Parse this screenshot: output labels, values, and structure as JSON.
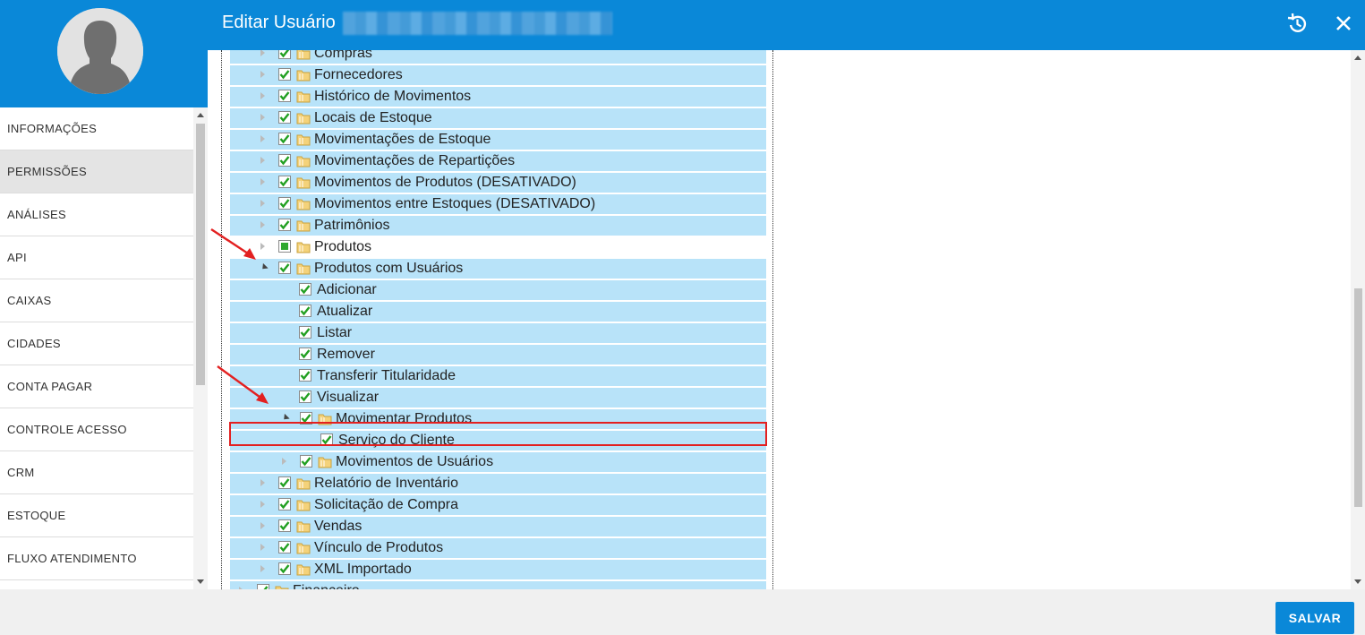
{
  "header": {
    "title": "Editar Usuário",
    "history_icon": "history-icon",
    "close_icon": "close-icon",
    "accent": "#0a88d8"
  },
  "sidebar": {
    "items": [
      {
        "label": "INFORMAÇÕES",
        "active": false
      },
      {
        "label": "PERMISSÕES",
        "active": true
      },
      {
        "label": "ANÁLISES",
        "active": false
      },
      {
        "label": "API",
        "active": false
      },
      {
        "label": "CAIXAS",
        "active": false
      },
      {
        "label": "CIDADES",
        "active": false
      },
      {
        "label": "CONTA PAGAR",
        "active": false
      },
      {
        "label": "CONTROLE ACESSO",
        "active": false
      },
      {
        "label": "CRM",
        "active": false
      },
      {
        "label": "ESTOQUE",
        "active": false
      },
      {
        "label": "FLUXO ATENDIMENTO",
        "active": false
      }
    ]
  },
  "tree": {
    "rows": [
      {
        "label": "Compras",
        "level": 2,
        "folder": true,
        "expander": "closed",
        "check": "full"
      },
      {
        "label": "Fornecedores",
        "level": 2,
        "folder": true,
        "expander": "closed",
        "check": "full"
      },
      {
        "label": "Histórico de Movimentos",
        "level": 2,
        "folder": true,
        "expander": "closed",
        "check": "full"
      },
      {
        "label": "Locais de Estoque",
        "level": 2,
        "folder": true,
        "expander": "closed",
        "check": "full"
      },
      {
        "label": "Movimentações de Estoque",
        "level": 2,
        "folder": true,
        "expander": "closed",
        "check": "full"
      },
      {
        "label": "Movimentações de Repartições",
        "level": 2,
        "folder": true,
        "expander": "closed",
        "check": "full"
      },
      {
        "label": "Movimentos de Produtos (DESATIVADO)",
        "level": 2,
        "folder": true,
        "expander": "closed",
        "check": "full"
      },
      {
        "label": "Movimentos entre Estoques (DESATIVADO)",
        "level": 2,
        "folder": true,
        "expander": "closed",
        "check": "full"
      },
      {
        "label": "Patrimônios",
        "level": 2,
        "folder": true,
        "expander": "closed",
        "check": "full"
      },
      {
        "label": "Produtos",
        "level": 2,
        "folder": true,
        "expander": "closed",
        "check": "partial",
        "plain": true
      },
      {
        "label": "Produtos com Usuários",
        "level": 2,
        "folder": true,
        "expander": "open",
        "check": "full"
      },
      {
        "label": "Adicionar",
        "level": 3,
        "folder": false,
        "expander": "none",
        "check": "full"
      },
      {
        "label": "Atualizar",
        "level": 3,
        "folder": false,
        "expander": "none",
        "check": "full"
      },
      {
        "label": "Listar",
        "level": 3,
        "folder": false,
        "expander": "none",
        "check": "full"
      },
      {
        "label": "Remover",
        "level": 3,
        "folder": false,
        "expander": "none",
        "check": "full"
      },
      {
        "label": "Transferir Titularidade",
        "level": 3,
        "folder": false,
        "expander": "none",
        "check": "full"
      },
      {
        "label": "Visualizar",
        "level": 3,
        "folder": false,
        "expander": "none",
        "check": "full"
      },
      {
        "label": "Movimentar Produtos",
        "level": 3,
        "folder": true,
        "expander": "open",
        "check": "full"
      },
      {
        "label": "Serviço do Cliente",
        "level": 4,
        "folder": false,
        "expander": "none",
        "check": "full",
        "highlight": true
      },
      {
        "label": "Movimentos de Usuários",
        "level": 3,
        "folder": true,
        "expander": "closed",
        "check": "full"
      },
      {
        "label": "Relatório de Inventário",
        "level": 2,
        "folder": true,
        "expander": "closed",
        "check": "full"
      },
      {
        "label": "Solicitação de Compra",
        "level": 2,
        "folder": true,
        "expander": "closed",
        "check": "full"
      },
      {
        "label": "Vendas",
        "level": 2,
        "folder": true,
        "expander": "closed",
        "check": "full"
      },
      {
        "label": "Vínculo de Produtos",
        "level": 2,
        "folder": true,
        "expander": "closed",
        "check": "full"
      },
      {
        "label": "XML Importado",
        "level": 2,
        "folder": true,
        "expander": "closed",
        "check": "full"
      },
      {
        "label": "Financeiro",
        "level": 1,
        "folder": true,
        "expander": "closed",
        "check": "full"
      }
    ],
    "row_color": "#b8e3f9",
    "highlight_color": "#e32020"
  },
  "footer": {
    "save_label": "SALVAR"
  }
}
